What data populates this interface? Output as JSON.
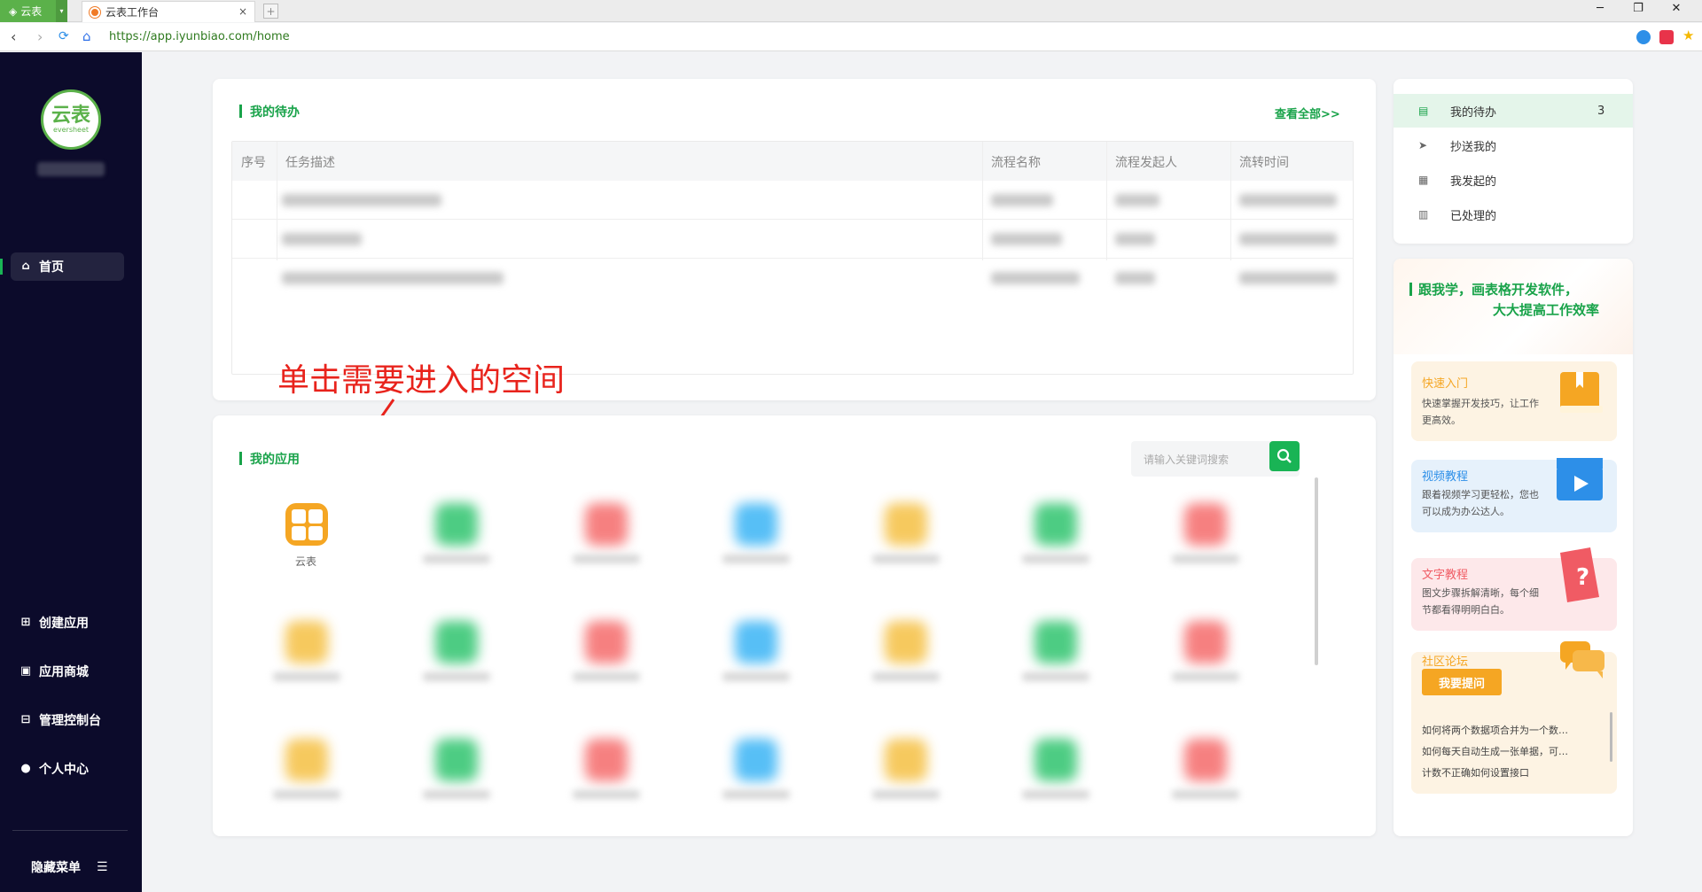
{
  "browser": {
    "app_name": "云表",
    "tab_title": "云表工作台",
    "tab_close": "×",
    "new_tab": "+",
    "url": "https://app.iyunbiao.com/home",
    "window_controls": [
      "─",
      "❐",
      "✕"
    ]
  },
  "sidebar": {
    "logo_text": "云表",
    "logo_sub": "eversheet",
    "nav": [
      {
        "label": "首页",
        "icon": "home-icon",
        "active": true
      },
      {
        "label": "创建应用",
        "icon": "create-app-icon"
      },
      {
        "label": "应用商城",
        "icon": "store-icon"
      },
      {
        "label": "管理控制台",
        "icon": "console-icon"
      },
      {
        "label": "个人中心",
        "icon": "user-icon"
      }
    ],
    "hide_menu": "隐藏菜单"
  },
  "todo": {
    "title": "我的待办",
    "view_all": "查看全部>>",
    "columns": [
      "序号",
      "任务描述",
      "流程名称",
      "流程发起人",
      "流转时间"
    ]
  },
  "annotation": "单击需要进入的空间",
  "apps": {
    "title": "我的应用",
    "search_placeholder": "请输入关键词搜索",
    "first_app_label": "云表"
  },
  "right_nav": [
    {
      "label": "我的待办",
      "icon": "todo-icon",
      "count": "3",
      "active": true
    },
    {
      "label": "抄送我的",
      "icon": "send-icon"
    },
    {
      "label": "我发起的",
      "icon": "initiated-icon"
    },
    {
      "label": "已处理的",
      "icon": "processed-icon"
    }
  ],
  "promo": {
    "line1": "跟我学，画表格开发软件，",
    "line2": "大大提高工作效率"
  },
  "tutorials": [
    {
      "title": "快速入门",
      "desc": "快速掌握开发技巧，让工作更高效。",
      "color": "#f5a623"
    },
    {
      "title": "视频教程",
      "desc": "跟着视频学习更轻松，您也可以成为办公达人。",
      "color": "#2d8fe8"
    },
    {
      "title": "文字教程",
      "desc": "图文步骤拆解清晰，每个细节都看得明明白白。",
      "color": "#f05b64"
    }
  ],
  "community": {
    "title": "社区论坛",
    "ask_button": "我要提问",
    "faqs": [
      "如何将两个数据项合并为一个数…",
      "如何每天自动生成一张单据，可…",
      "计数不正确如何设置接口"
    ]
  }
}
